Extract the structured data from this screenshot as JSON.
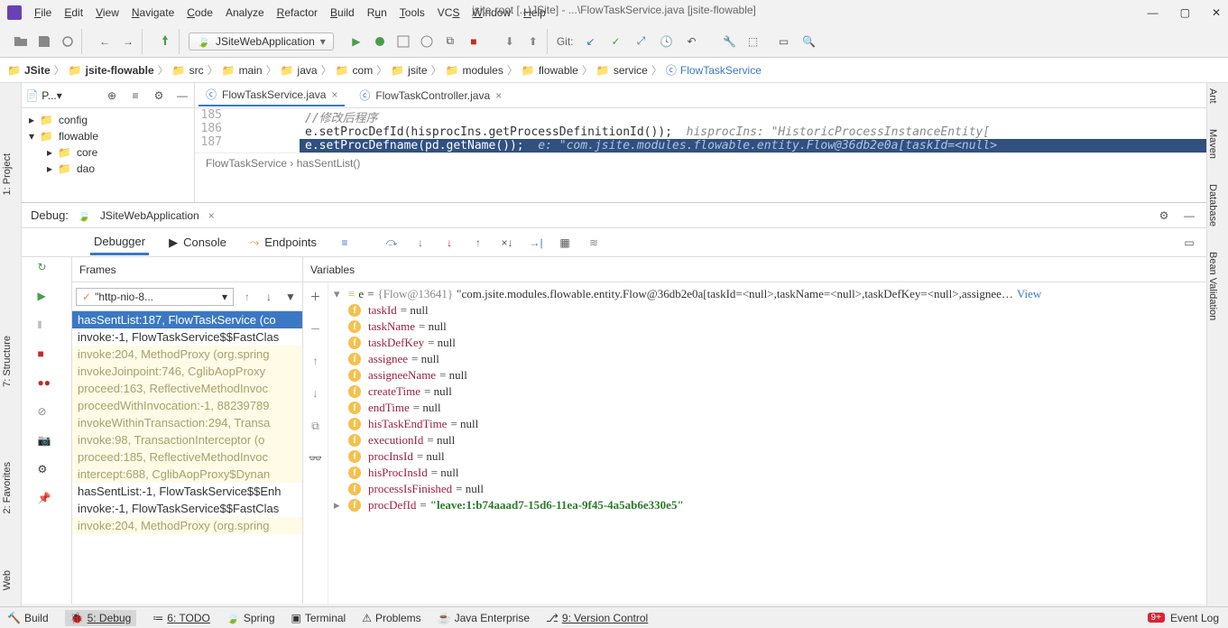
{
  "menu": {
    "file": "File",
    "edit": "Edit",
    "view": "View",
    "navigate": "Navigate",
    "code": "Code",
    "analyze": "Analyze",
    "refactor": "Refactor",
    "build": "Build",
    "run": "Run",
    "tools": "Tools",
    "vcs": "VCS",
    "window": "Window",
    "help": "Help"
  },
  "window_title": "jsite-root [...\\JSite] - ...\\FlowTaskService.java [jsite-flowable]",
  "toolbar": {
    "run_config": "JSiteWebApplication",
    "git_label": "Git:"
  },
  "breadcrumb": [
    "JSite",
    "jsite-flowable",
    "src",
    "main",
    "java",
    "com",
    "jsite",
    "modules",
    "flowable",
    "service",
    "FlowTaskService"
  ],
  "project_tree": {
    "label": "P...",
    "items": [
      "config",
      "flowable",
      "core",
      "dao"
    ]
  },
  "editor": {
    "tabs": [
      {
        "name": "FlowTaskService.java",
        "active": true
      },
      {
        "name": "FlowTaskController.java",
        "active": false
      }
    ],
    "lines": [
      {
        "num": "185",
        "text": "//修改后程序",
        "comment": true
      },
      {
        "num": "186",
        "text": "e.setProcDefId(hisprocIns.getProcessDefinitionId());",
        "hint": "hisprocIns: \"HistoricProcessInstanceEntity["
      },
      {
        "num": "187",
        "text": "e.setProcDefname(pd.getName());",
        "hint": "e: \"com.jsite.modules.flowable.entity.Flow@36db2e0a[taskId=<null>",
        "selected": true
      }
    ],
    "structure_path": "FlowTaskService  ›  hasSentList()"
  },
  "debug": {
    "title": "Debug:",
    "config": "JSiteWebApplication",
    "tabs": [
      "Debugger",
      "Console",
      "Endpoints"
    ],
    "frames_label": "Frames",
    "variables_label": "Variables",
    "thread": "\"http-nio-8...",
    "frames": [
      {
        "t": "hasSentList:187, FlowTaskService (co",
        "sel": true
      },
      {
        "t": "invoke:-1, FlowTaskService$$FastClas"
      },
      {
        "t": "invoke:204, MethodProxy (org.spring",
        "alt": true
      },
      {
        "t": "invokeJoinpoint:746, CglibAopProxy",
        "alt": true
      },
      {
        "t": "proceed:163, ReflectiveMethodInvoc",
        "alt": true
      },
      {
        "t": "proceedWithInvocation:-1, 88239789",
        "alt": true
      },
      {
        "t": "invokeWithinTransaction:294, Transa",
        "alt": true
      },
      {
        "t": "invoke:98, TransactionInterceptor (o",
        "alt": true
      },
      {
        "t": "proceed:185, ReflectiveMethodInvoc",
        "alt": true
      },
      {
        "t": "intercept:688, CglibAopProxy$Dynan",
        "alt": true
      },
      {
        "t": "hasSentList:-1, FlowTaskService$$Enh"
      },
      {
        "t": "invoke:-1, FlowTaskService$$FastClas"
      },
      {
        "t": "invoke:204, MethodProxy (org.spring",
        "alt": true
      }
    ],
    "root_var": {
      "name": "e",
      "id": "{Flow@13641}",
      "str": "\"com.jsite.modules.flowable.entity.Flow@36db2e0a[taskId=<null>,taskName=<null>,taskDefKey=<null>,assignee…",
      "view": "View"
    },
    "fields": [
      {
        "n": "taskId",
        "v": "= null"
      },
      {
        "n": "taskName",
        "v": "= null"
      },
      {
        "n": "taskDefKey",
        "v": "= null"
      },
      {
        "n": "assignee",
        "v": "= null"
      },
      {
        "n": "assigneeName",
        "v": "= null"
      },
      {
        "n": "createTime",
        "v": "= null"
      },
      {
        "n": "endTime",
        "v": "= null"
      },
      {
        "n": "hisTaskEndTime",
        "v": "= null"
      },
      {
        "n": "executionId",
        "v": "= null"
      },
      {
        "n": "procInsId",
        "v": "= null"
      },
      {
        "n": "hisProcInsId",
        "v": "= null"
      },
      {
        "n": "processIsFinished",
        "v": "= null"
      },
      {
        "n": "procDefId",
        "v": "= \"leave:1:b74aaad7-15d6-11ea-9f45-4a5ab6e330e5\"",
        "green": true,
        "expand": true
      }
    ]
  },
  "leftbar": [
    "1: Project",
    "7: Structure",
    "2: Favorites",
    "Web"
  ],
  "rightbar": [
    "Ant",
    "Maven",
    "Database",
    "Bean Validation"
  ],
  "statusbar": {
    "build": "Build",
    "debug": "5: Debug",
    "todo": "6: TODO",
    "spring": "Spring",
    "terminal": "Terminal",
    "problems": "Problems",
    "java": "Java Enterprise",
    "vcs": "9: Version Control",
    "eventlog": "Event Log",
    "badge": "9+"
  }
}
